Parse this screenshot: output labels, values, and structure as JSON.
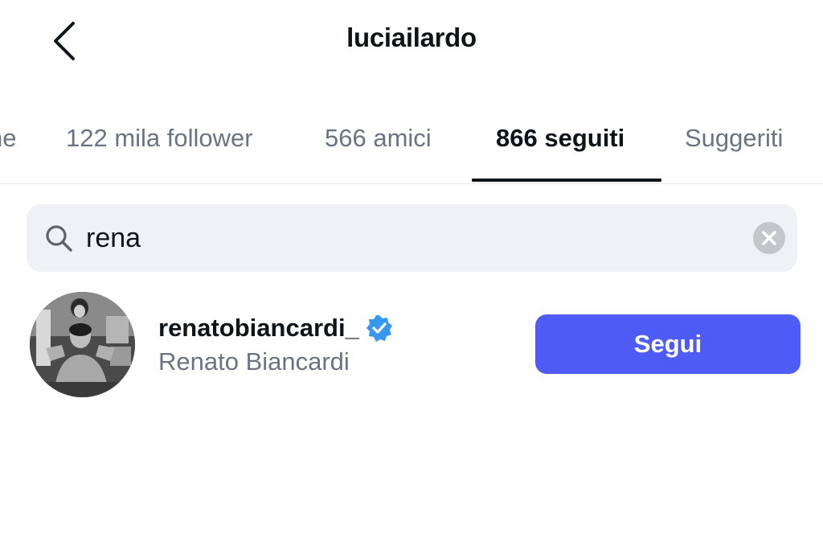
{
  "header": {
    "title": "luciailardo",
    "back_icon": "chevron-left-icon"
  },
  "tabs": [
    {
      "label": "ne"
    },
    {
      "label": "122 mila follower"
    },
    {
      "label": "566 amici"
    },
    {
      "label": "866 seguiti",
      "active": true
    },
    {
      "label": "Suggeriti"
    }
  ],
  "search": {
    "value": "rena",
    "icon": "search-icon",
    "clear_icon": "clear-icon"
  },
  "results": [
    {
      "username": "renatobiancardi_",
      "verified": true,
      "full_name": "Renato Biancardi",
      "follow_label": "Segui"
    }
  ],
  "colors": {
    "accent": "#4e5cf5",
    "verified": "#3897f0",
    "secondary_text": "#6b7280",
    "search_bg": "#eff1f4"
  }
}
